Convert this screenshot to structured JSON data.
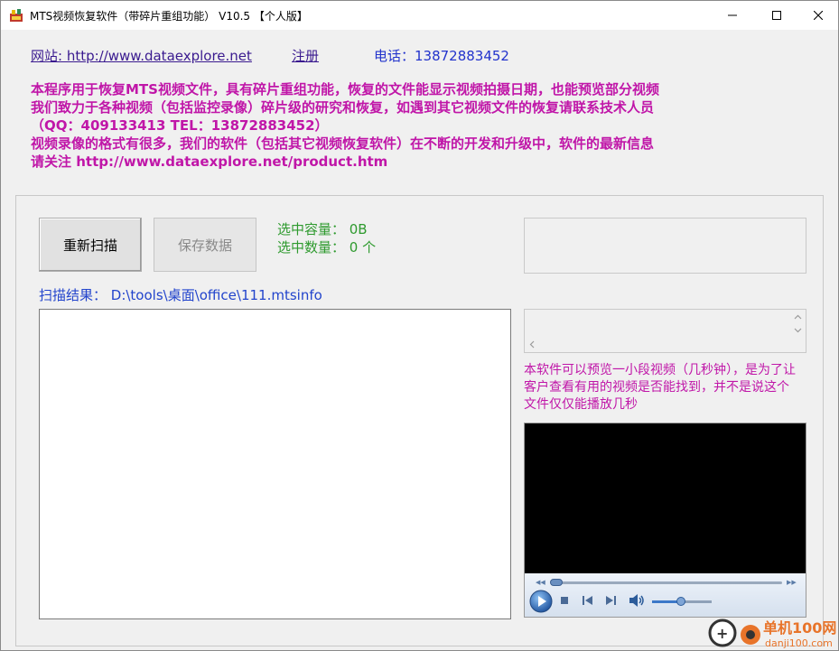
{
  "window": {
    "title": "MTS视频恢复软件（带碎片重组功能） V10.5 【个人版】"
  },
  "header": {
    "site": "网站: http://www.dataexplore.net",
    "register": "注册",
    "phone": "电话：13872883452"
  },
  "intro": {
    "lines": [
      "本程序用于恢复MTS视频文件，具有碎片重组功能，恢复的文件能显示视频拍摄日期，也能预览部分视频",
      "我们致力于各种视频（包括监控录像）碎片级的研究和恢复，如遇到其它视频文件的恢复请联系技术人员",
      "（QQ：409133413  TEL：13872883452）",
      "视频录像的格式有很多，我们的软件（包括其它视频恢复软件）在不断的开发和升级中，软件的最新信息",
      "请关注 http://www.dataexplore.net/product.htm"
    ]
  },
  "toolbar": {
    "rescan": "重新扫描",
    "save": "保存数据"
  },
  "stats": {
    "size": "选中容量：  0B",
    "count": "选中数量：  0 个"
  },
  "scan": {
    "result": "扫描结果：  D:\\tools\\桌面\\office\\111.mtsinfo"
  },
  "preview": {
    "note": "本软件可以预览一小段视频（几秒钟），是为了让客户查看有用的视频是否能找到，并不是说这个文件仅仅能播放几秒"
  },
  "watermark": {
    "text": "单机100网",
    "url": "danji100.com"
  },
  "colors": {
    "intro": "#c016a8",
    "stats": "#2e9a2e",
    "link": "#3a1a8f",
    "phone": "#2233cc"
  }
}
